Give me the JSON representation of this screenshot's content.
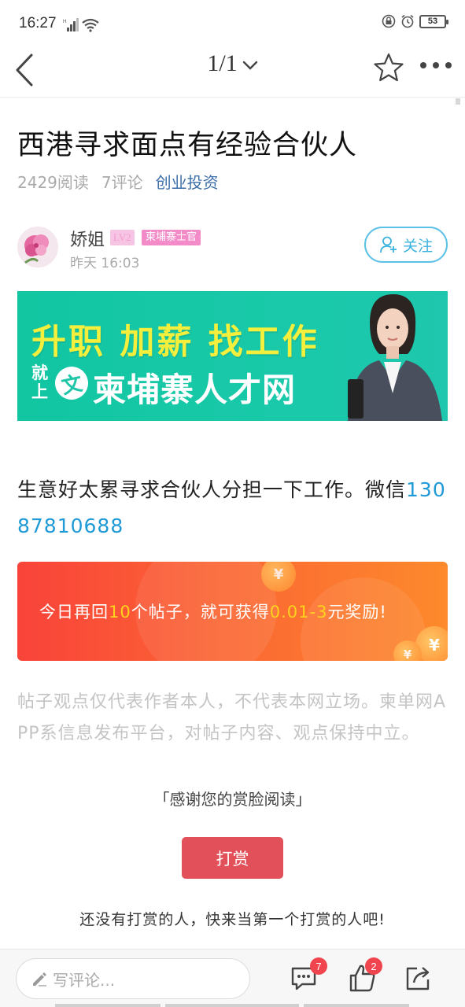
{
  "status_bar": {
    "time": "16:27",
    "battery": "53"
  },
  "nav": {
    "page_indicator": "1/1"
  },
  "article": {
    "title": "西港寻求面点有经验合伙人",
    "read_count": "2429阅读",
    "comment_count": "7评论",
    "category": "创业投资"
  },
  "author": {
    "name": "娇姐",
    "level": "LV2",
    "title_badge": "柬埔寨士官",
    "time": "昨天 16:03",
    "follow_label": "关注"
  },
  "banner": {
    "line1": "升职 加薪 找工作",
    "jiu_shang": "就上",
    "logo_char": "文",
    "line2": "柬埔寨人才网"
  },
  "post": {
    "body": "生意好太累寻求合伙人分担一下工作。微信",
    "phone": "13087810688"
  },
  "reward": {
    "prefix": "今日再回",
    "count": "10",
    "middle": "个帖子，就可获得",
    "amount": "0.01-3",
    "suffix": "元奖励!",
    "coin_symbol": "¥"
  },
  "disclaimer": "帖子观点仅代表作者本人，不代表本网立场。柬单网APP系信息发布平台，对帖子内容、观点保持中立。",
  "tip": {
    "thanks": "「感谢您的赏脸阅读」",
    "button_label": "打赏",
    "no_tippers": "还没有打赏的人，快来当第一个打赏的人吧!"
  },
  "bottom_bar": {
    "comment_placeholder": "写评论...",
    "comment_badge": "7",
    "like_badge": "2"
  },
  "colors": {
    "accent_blue": "#3ab2de",
    "category_blue": "#3d6fa8",
    "tip_red": "#e2515a",
    "badge_red": "#f0444e"
  }
}
